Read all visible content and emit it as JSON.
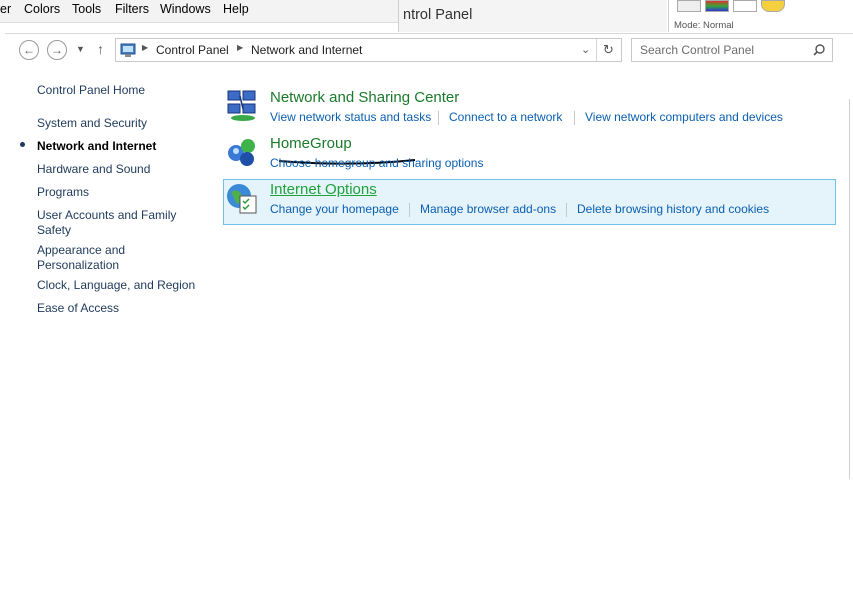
{
  "menubar": {
    "items": [
      "er",
      "Colors",
      "Tools",
      "Filters",
      "Windows",
      "Help"
    ]
  },
  "background_window": {
    "title": "ntrol Panel",
    "mode": "Mode: Normal"
  },
  "address": {
    "crumbs": [
      "Control Panel",
      "Network and Internet"
    ]
  },
  "search": {
    "placeholder": "Search Control Panel"
  },
  "sidebar": {
    "home": "Control Panel Home",
    "items": [
      "System and Security",
      "Network and Internet",
      "Hardware and Sound",
      "Programs",
      "User Accounts and Family Safety",
      "Appearance and Personalization",
      "Clock, Language, and Region",
      "Ease of Access"
    ],
    "current": "Network and Internet"
  },
  "categories": [
    {
      "title": "Network and Sharing Center",
      "icon": "network-sharing-icon",
      "tasks": [
        "View network status and tasks",
        "Connect to a network",
        "View network computers and devices"
      ]
    },
    {
      "title": "HomeGroup",
      "icon": "homegroup-icon",
      "tasks": [
        "Choose homegroup and sharing options"
      ]
    },
    {
      "title": "Internet Options",
      "icon": "internet-options-icon",
      "tasks": [
        "Change your homepage",
        "Manage browser add-ons",
        "Delete browsing history and cookies"
      ]
    }
  ],
  "colors": {
    "title_green": "#1a7a2a",
    "link_blue": "#0b5fb0",
    "highlight_bg": "#e5f3fb",
    "highlight_border": "#70c0e7"
  }
}
